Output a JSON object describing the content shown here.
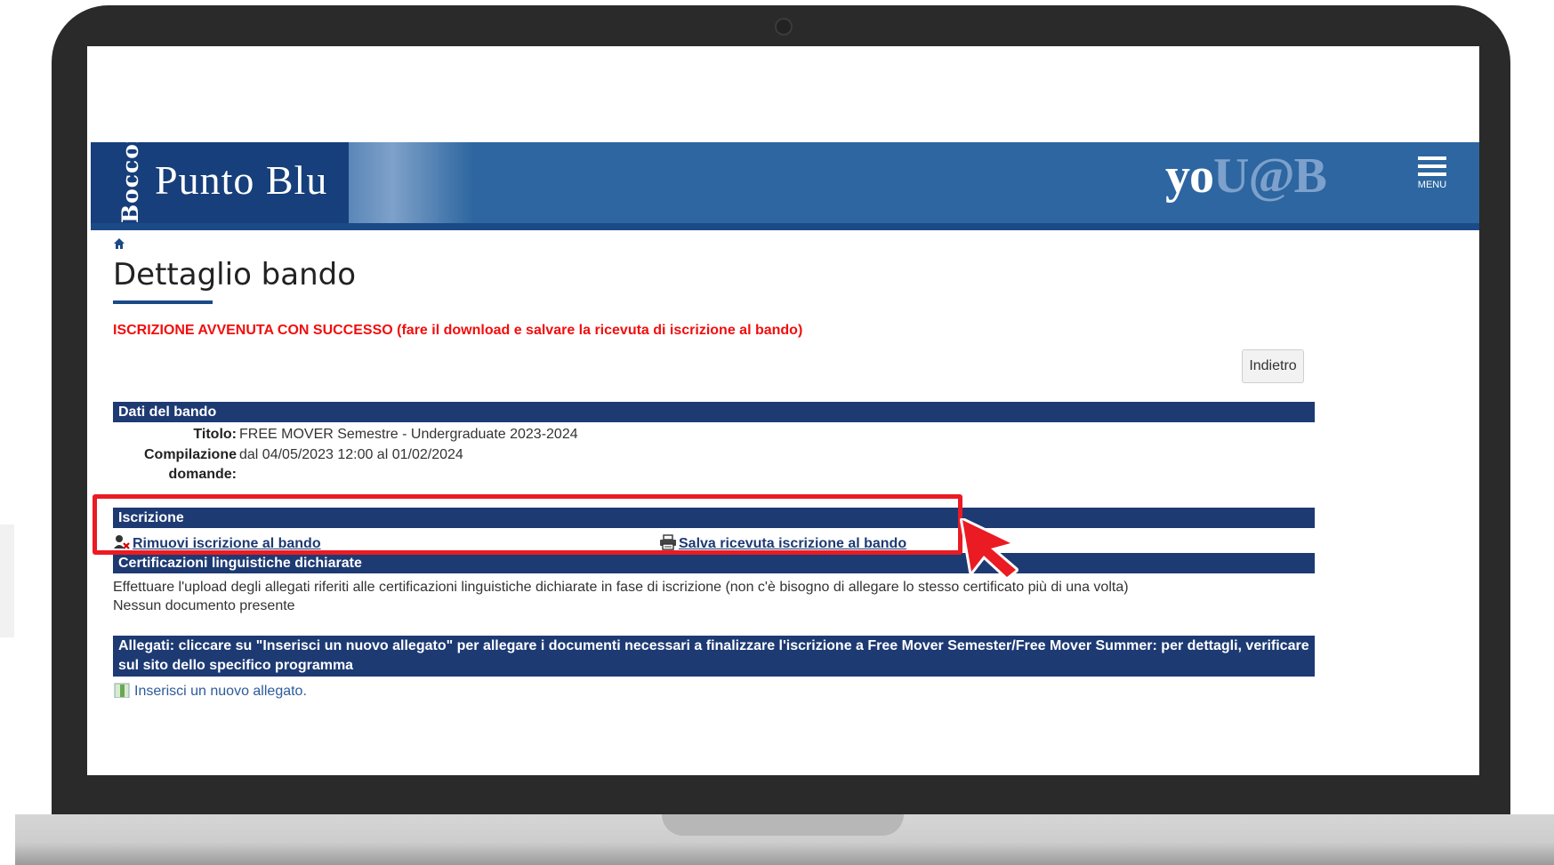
{
  "header": {
    "logo_vertical": "Bocconi",
    "logo_title": "Punto Blu",
    "brand_part_a": "yo",
    "brand_part_b": "U@B",
    "menu_label": "MENU"
  },
  "page": {
    "title": "Dettaglio bando",
    "success_message": "ISCRIZIONE AVVENUTA CON SUCCESSO (fare il download e salvare la ricevuta di iscrizione al bando)",
    "back_button_label": "Indietro"
  },
  "dati_bando": {
    "section_title": "Dati del bando",
    "titolo_label": "Titolo:",
    "titolo_value": "FREE MOVER Semestre - Undergraduate 2023-2024",
    "compilazione_label_line1": "Compilazione",
    "compilazione_label_line2": "domande:",
    "compilazione_value": "dal 04/05/2023 12:00 al 01/02/2024"
  },
  "iscrizione": {
    "section_title": "Iscrizione",
    "remove_link": "Rimuovi iscrizione al bando",
    "save_link": "Salva ricevuta iscrizione al bando"
  },
  "certificazioni": {
    "section_title": "Certificazioni linguistiche dichiarate",
    "description": "Effettuare l'upload degli allegati riferiti alle certificazioni linguistiche dichiarate in fase di iscrizione (non c'è bisogno di allegare lo stesso certificato più di una volta)",
    "empty_text": "Nessun documento presente"
  },
  "allegati": {
    "section_title": "Allegati: cliccare su \"Inserisci un nuovo allegato\" per allegare i documenti necessari a finalizzare l'iscrizione a Free Mover Semester/Free Mover Summer: per dettagli, verificare sul sito dello specifico programma",
    "insert_link": "Inserisci un nuovo allegato."
  },
  "colors": {
    "header_blue": "#2d66a0",
    "logo_blue": "#163f7b",
    "section_bar": "#1d3a73",
    "success_red": "#f20d0d",
    "highlight_red": "#ea1b23"
  },
  "icons": {
    "home": "home-icon",
    "menu": "hamburger-menu-icon",
    "remove": "remove-user-icon",
    "save": "printer-icon",
    "insert": "document-add-icon",
    "cursor": "cursor-arrow-icon"
  }
}
